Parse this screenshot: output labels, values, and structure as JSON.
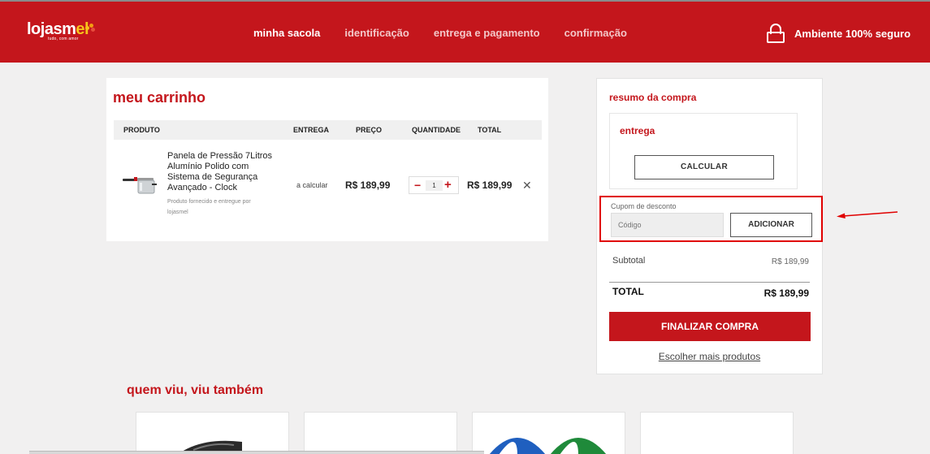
{
  "header": {
    "logo_main": "lojasm",
    "logo_accent": "el",
    "logo_tagline": "tudo, com amor",
    "steps": [
      {
        "label": "minha sacola"
      },
      {
        "label": "identificação"
      },
      {
        "label": "entrega e pagamento"
      },
      {
        "label": "confirmação"
      }
    ],
    "secure_text": "Ambiente 100% seguro",
    "lock_icon": "lock-icon"
  },
  "cart": {
    "title": "meu carrinho",
    "columns": [
      "PRODUTO",
      "ENTREGA",
      "PREÇO",
      "QUANTIDADE",
      "TOTAL"
    ],
    "item": {
      "name": "Panela de Pressão 7Litros Alumínio Polido com Sistema de Segurança Avançado - Clock",
      "seller": "Produto fornecido e entregue por lojasmel",
      "delivery": "a calcular",
      "price": "R$ 189,99",
      "quantity": "1",
      "minus": "−",
      "plus": "+",
      "total": "R$ 189,99",
      "remove": "✕"
    }
  },
  "summary": {
    "title": "resumo da compra",
    "shipping_title": "entrega",
    "calculate_label": "CALCULAR",
    "coupon_label": "Cupom de desconto",
    "coupon_placeholder": "Código",
    "coupon_button": "ADICIONAR",
    "subtotal_label": "Subtotal",
    "subtotal_value": "R$ 189,99",
    "total_label": "TOTAL",
    "total_value": "R$ 189,99",
    "finalize_label": "FINALIZAR COMPRA",
    "more_products": "Escolher mais produtos"
  },
  "recommendations": {
    "title": "quem viu, viu também"
  },
  "colors": {
    "brand_red": "#c4161c",
    "highlight_red": "#e00000",
    "logo_yellow": "#f7c31a"
  }
}
